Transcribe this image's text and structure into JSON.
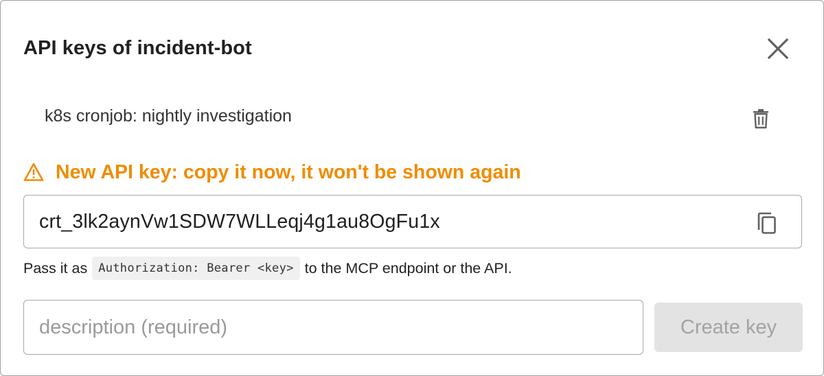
{
  "dialog": {
    "title": "API keys of incident-bot"
  },
  "keys": [
    {
      "description": "k8s cronjob: nightly investigation"
    }
  ],
  "new_key": {
    "warning": "New API key: copy it now, it won't be shown again",
    "value": "crt_3lk2aynVw1SDW7WLLeqj4g1au8OgFu1x"
  },
  "hint": {
    "prefix": "Pass it as",
    "code": "Authorization: Bearer <key>",
    "suffix": "to the MCP endpoint or the API."
  },
  "form": {
    "description_placeholder": "description (required)",
    "description_value": "",
    "create_label": "Create key"
  },
  "colors": {
    "warning": "#f08c00",
    "icon": "#616161",
    "button_disabled_bg": "#e3e3e3",
    "button_disabled_text": "#a3a3a3"
  },
  "icons": {
    "close": "close-icon",
    "delete": "trash-icon",
    "warning": "warning-triangle-icon",
    "copy": "copy-icon"
  }
}
